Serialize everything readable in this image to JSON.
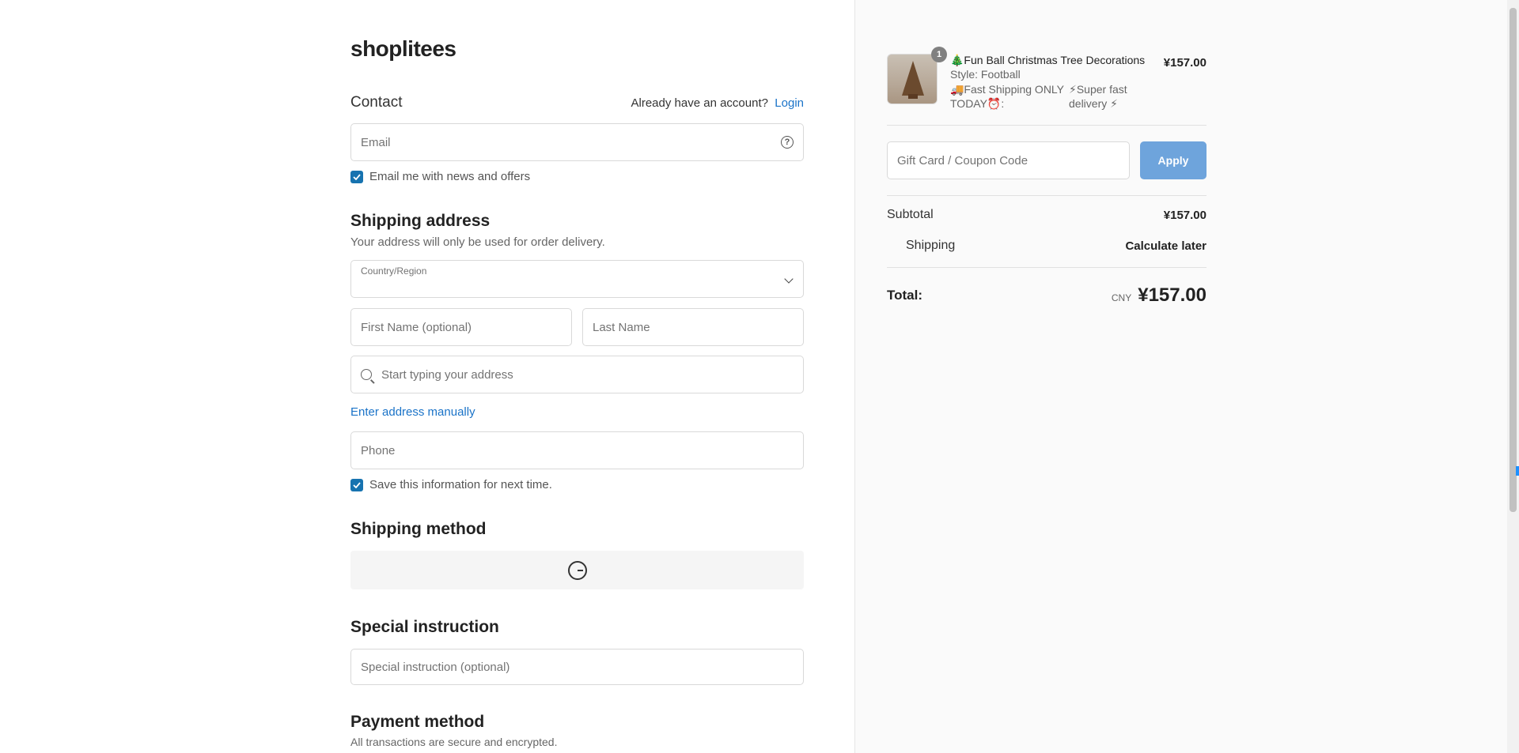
{
  "store": {
    "name": "shoplitees"
  },
  "contact": {
    "title": "Contact",
    "account_prompt": "Already have an account?",
    "login_label": "Login",
    "email_placeholder": "Email",
    "newsletter_label": "Email me with news and offers",
    "newsletter_checked": true
  },
  "shipping_address": {
    "title": "Shipping address",
    "subtitle": "Your address will only be used for order delivery.",
    "country_label": "Country/Region",
    "country_value": "",
    "first_name_placeholder": "First Name (optional)",
    "last_name_placeholder": "Last Name",
    "address_placeholder": "Start typing your address",
    "manual_link": "Enter address manually",
    "phone_placeholder": "Phone",
    "save_info_label": "Save this information for next time.",
    "save_info_checked": true
  },
  "shipping_method": {
    "title": "Shipping method",
    "state": "loading"
  },
  "special_instruction": {
    "title": "Special instruction",
    "placeholder": "Special instruction (optional)"
  },
  "payment": {
    "title": "Payment method",
    "subtitle": "All transactions are secure and encrypted."
  },
  "summary": {
    "item": {
      "quantity": "1",
      "name": "🎄Fun Ball Christmas Tree Decorations",
      "style": "Style: Football",
      "option1": "🚚Fast Shipping ONLY TODAY⏰:",
      "option2": "⚡Super fast delivery ⚡",
      "price": "¥157.00"
    },
    "coupon_placeholder": "Gift Card / Coupon Code",
    "apply_label": "Apply",
    "subtotal_label": "Subtotal",
    "subtotal_value": "¥157.00",
    "shipping_label": "Shipping",
    "shipping_value": "Calculate later",
    "total_label": "Total:",
    "total_currency": "CNY",
    "total_value": "¥157.00"
  },
  "colors": {
    "accent": "#1773b0",
    "apply_button": "#6ea4dc",
    "summary_background": "#fafafa"
  }
}
